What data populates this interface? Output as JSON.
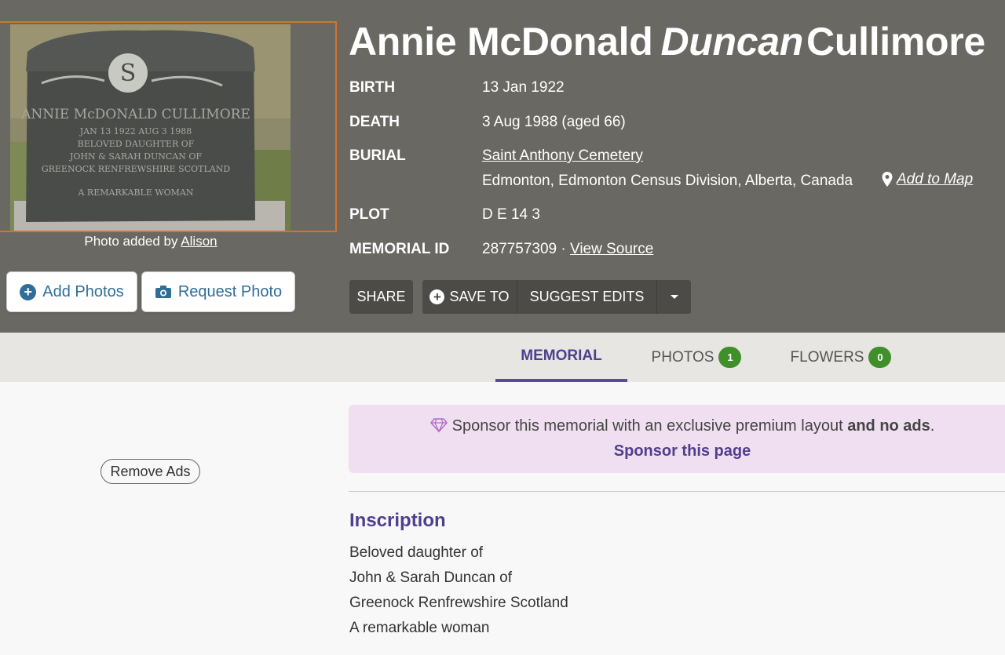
{
  "memorial": {
    "first_names": "Annie McDonald",
    "maiden_name": "Duncan",
    "last_name": "Cullimore"
  },
  "photo": {
    "caption_prefix": "Photo added by",
    "added_by": "Alison",
    "stone": {
      "line1": "ANNIE McDONALD CULLIMORE",
      "line2": "JAN 13 1922     AUG 3 1988",
      "line3": "BELOVED DAUGHTER OF",
      "line4": "JOHN & SARAH DUNCAN OF",
      "line5": "GREENOCK RENFREWSHIRE SCOTLAND",
      "line6": "A REMARKABLE WOMAN"
    }
  },
  "photo_buttons": {
    "add": "Add Photos",
    "request": "Request Photo"
  },
  "facts": {
    "birth_label": "BIRTH",
    "birth": "13 Jan 1922",
    "death_label": "DEATH",
    "death": "3 Aug 1988 (aged 66)",
    "burial_label": "BURIAL",
    "cemetery": "Saint Anthony Cemetery",
    "location": "Edmonton, Edmonton Census Division, Alberta, Canada",
    "add_to_map": "Add to Map",
    "plot_label": "PLOT",
    "plot": "D E 14 3",
    "memorial_id_label": "MEMORIAL ID",
    "memorial_id": "287757309 ·",
    "view_source": "View Source"
  },
  "actions": {
    "share": "SHARE",
    "save_to": "SAVE TO",
    "suggest_edits": "SUGGEST EDITS"
  },
  "tabs": {
    "memorial": "MEMORIAL",
    "photos": "PHOTOS",
    "photos_count": "1",
    "flowers": "FLOWERS",
    "flowers_count": "0"
  },
  "ads": {
    "remove": "Remove Ads"
  },
  "sponsor": {
    "text": "Sponsor this memorial with an exclusive premium layout",
    "bold": "and no ads",
    "period": ".",
    "link": "Sponsor this page"
  },
  "inscription": {
    "title": "Inscription",
    "lines": [
      "Beloved daughter of",
      "John & Sarah Duncan of",
      "Greenock Renfrewshire Scotland",
      "A remarkable woman"
    ]
  },
  "colors": {
    "hero_bg": "#6a6863",
    "accent_purple": "#4f3f8f",
    "link_blue": "#2f6e98",
    "badge_green": "#3f8f2a",
    "sponsor_bg": "#f0dff0",
    "photo_border": "#d9712a"
  }
}
